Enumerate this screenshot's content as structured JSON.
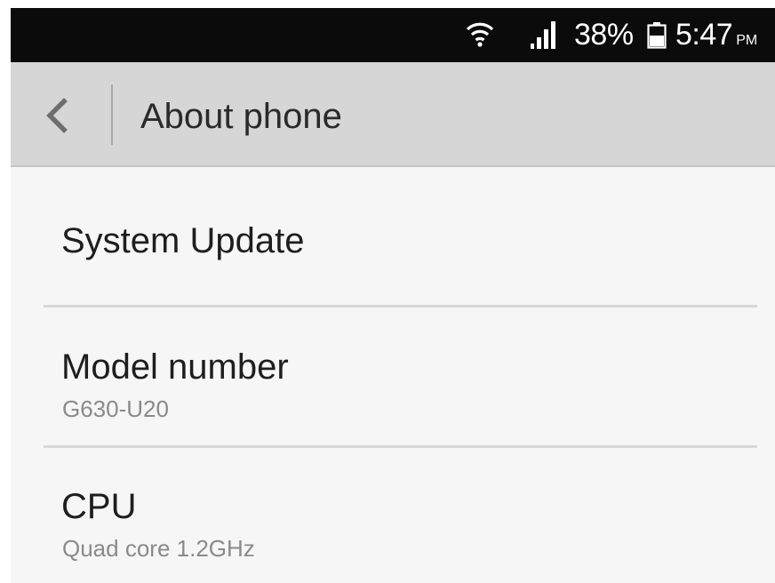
{
  "status_bar": {
    "battery_percent": "38%",
    "time": "5:47",
    "ampm": "PM",
    "icons": [
      "wifi-icon",
      "signal-icon",
      "battery-icon"
    ]
  },
  "action_bar": {
    "title": "About phone",
    "back_icon": "chevron-left-icon"
  },
  "items": [
    {
      "title": "System Update",
      "subtitle": ""
    },
    {
      "title": "Model number",
      "subtitle": "G630-U20"
    },
    {
      "title": "CPU",
      "subtitle": "Quad core 1.2GHz"
    }
  ],
  "colors": {
    "status_bar_bg": "#0b0b0b",
    "action_bar_bg": "#d6d6d6",
    "list_bg": "#f6f6f6",
    "primary_text": "#1e1e1e",
    "secondary_text": "#8a8a8a"
  }
}
